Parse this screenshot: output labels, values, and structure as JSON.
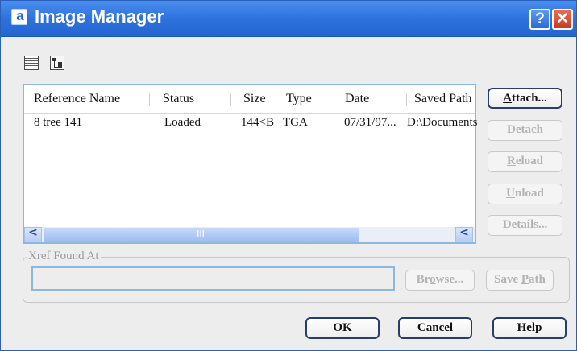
{
  "window": {
    "app_icon_letter": "a",
    "title": "Image Manager",
    "help_label": "?",
    "close_label": "✕"
  },
  "toolbar": {
    "list_view_icon": "list-view-icon",
    "tree_view_icon": "tree-view-icon"
  },
  "list": {
    "columns": [
      "Reference Name",
      "Status",
      "Size",
      "Type",
      "Date",
      "Saved Path"
    ],
    "rows": [
      {
        "reference_name": "8 tree 141",
        "status": "Loaded",
        "size": "144<B",
        "type": "TGA",
        "date": "07/31/97...",
        "saved_path": "D:\\Documents"
      }
    ],
    "scroll_left": "<",
    "scroll_right": "<",
    "scroll_grip": "III"
  },
  "side_buttons": {
    "attach": {
      "pre": "",
      "key": "A",
      "post": "ttach..."
    },
    "detach": {
      "pre": "",
      "key": "D",
      "post": "etach"
    },
    "reload": {
      "pre": "",
      "key": "R",
      "post": "eload"
    },
    "unload": {
      "pre": "",
      "key": "U",
      "post": "nload"
    },
    "details": {
      "pre": "",
      "key": "D",
      "post": "etails..."
    }
  },
  "xref": {
    "legend": "Xref Found At",
    "path_value": "",
    "browse": {
      "pre": "Br",
      "key": "o",
      "post": "wse..."
    },
    "save_path": {
      "pre": "Save ",
      "key": "P",
      "post": "ath"
    }
  },
  "footer": {
    "ok": "OK",
    "cancel": "Cancel",
    "help": {
      "pre": "H",
      "key": "e",
      "post": "lp"
    }
  },
  "colors": {
    "titlebar": "#2e72de",
    "list_border": "#8fb7d9",
    "disabled_text": "#b3b3b3"
  }
}
